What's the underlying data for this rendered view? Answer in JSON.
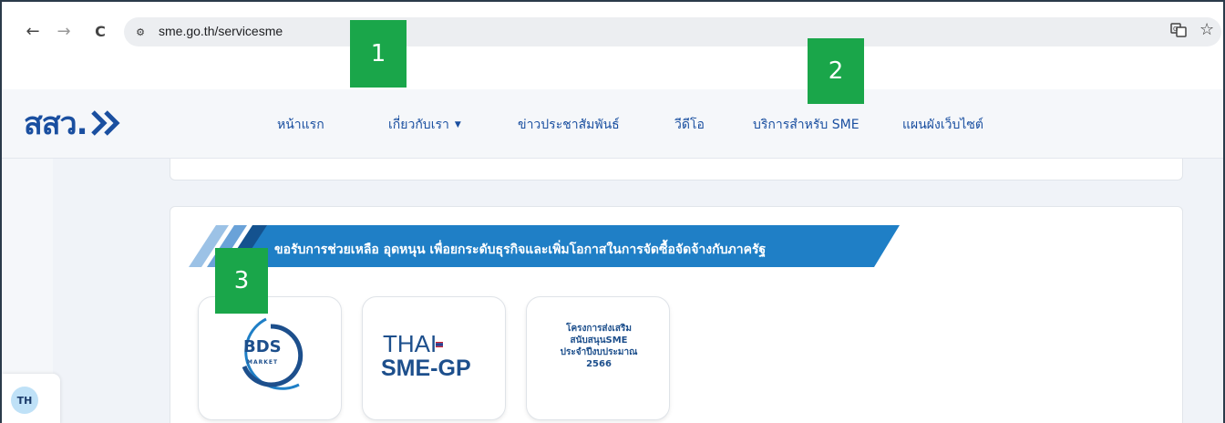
{
  "browser": {
    "url": "sme.go.th/servicesme",
    "back_icon": "←",
    "forward_icon": "→",
    "reload_icon": "C",
    "site_info_icon": "⚙",
    "translate_icon": "⟰",
    "bookmark_icon": "☆"
  },
  "site": {
    "logo_text": "สสว.",
    "menu": [
      {
        "label": "หน้าแรก"
      },
      {
        "label": "เกี่ยวกับเรา"
      },
      {
        "label": "ข่าวประชาสัมพันธ์"
      },
      {
        "label": "วีดีโอ"
      },
      {
        "label": "บริการสำหรับ SME"
      },
      {
        "label": "แผนผังเว็บไซต์"
      }
    ],
    "dropdown_caret": "▼",
    "banner_text": "ขอรับการช่วยเหลือ อุดหนุน เพื่อยกระดับธุรกิจและเพิ่มโอกาสในการจัดซื้อจัดจ้างกับภาครัฐ",
    "services": {
      "bds": {
        "word": "BDS",
        "sub": "MARKET"
      },
      "thai_sme_gp": {
        "top": "THAI",
        "bottom": "SME-GP"
      },
      "promo": {
        "lines": [
          "โครงการส่งเสริม",
          "สนับสนุนSME",
          "ประจำปีงบประมาณ",
          "2566"
        ]
      }
    },
    "language": "TH"
  },
  "markers": [
    "1",
    "2",
    "3"
  ],
  "colors": {
    "brand_blue": "#1a4fa0",
    "banner_blue": "#1f7fc6",
    "marker_green": "#1aa64a",
    "lang_bg": "#bfe1f7"
  }
}
